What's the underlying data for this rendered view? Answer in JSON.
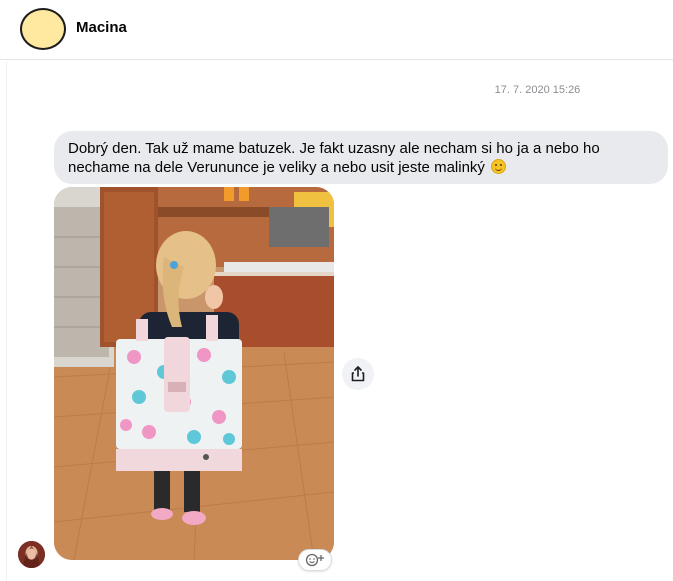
{
  "conversation": {
    "contact_name": "Macina",
    "timestamp": "17. 7. 2020 15:26"
  },
  "message": {
    "text": "Dobrý den.  Tak už  mame batuzek. Je fakt uzasny ale necham si ho ja a nebo ho nechame na dele Verununce je veliky a nebo usit jeste malinký",
    "emoji": "slightly-smiling-face-icon"
  },
  "attachment": {
    "type": "photo",
    "subject": "child-with-flamingo-backpack"
  },
  "actions": {
    "share_icon": "share-icon",
    "react_icon": "add-reaction-icon"
  },
  "colors": {
    "bubble_bg": "#e9eaed",
    "header_avatar_bg": "#ffe9a1",
    "timestamp": "#8a8d91"
  }
}
